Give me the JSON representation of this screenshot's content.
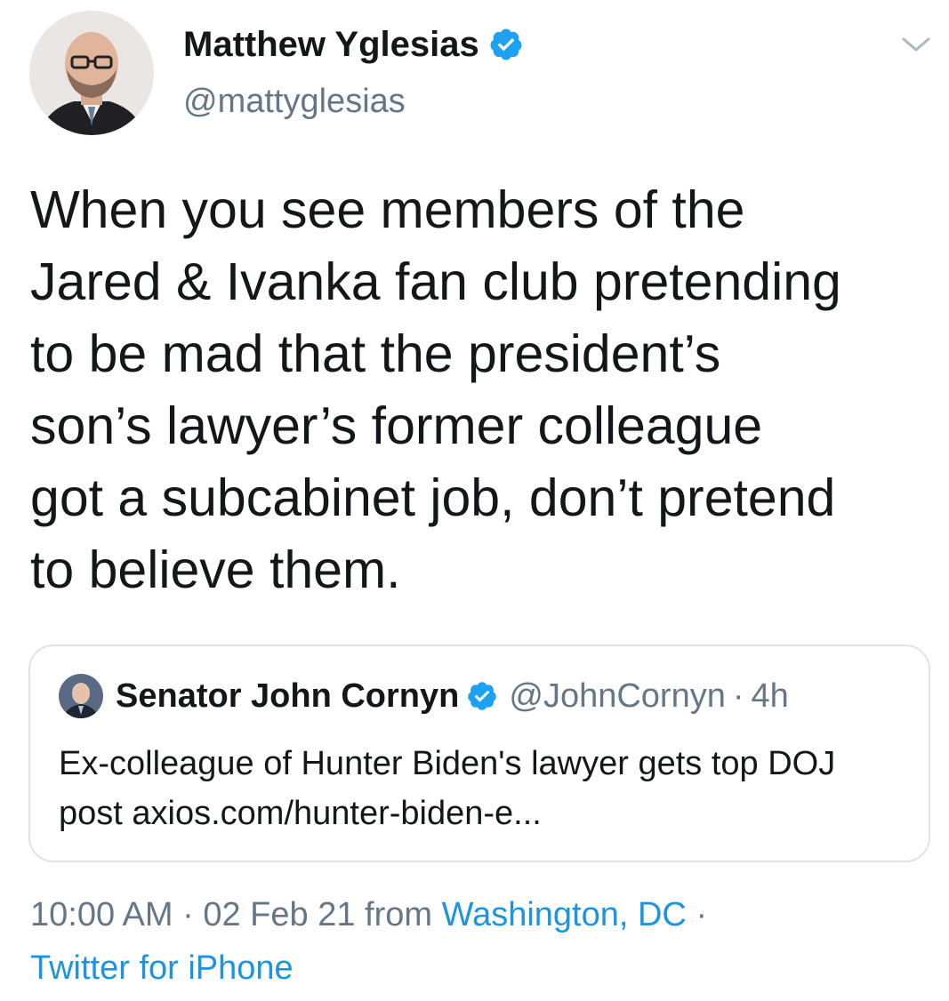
{
  "author": {
    "display_name": "Matthew Yglesias",
    "handle": "@mattyglesias",
    "verified": true
  },
  "tweet": {
    "text": "When you see members of the\nJared & Ivanka fan club pretending\nto be mad that the president’s\nson’s lawyer’s former colleague\ngot a subcabinet job, don’t pretend\nto believe them."
  },
  "quoted_tweet": {
    "display_name": "Senator John Cornyn",
    "handle": "@JohnCornyn",
    "separator": "·",
    "time": "4h",
    "text": "Ex-colleague of Hunter Biden's lawyer gets top DOJ post axios.com/hunter-biden-e...",
    "verified": true
  },
  "meta": {
    "time": "10:00 AM",
    "separator": "·",
    "date": "02 Feb 21",
    "from_label": "from",
    "location": "Washington, DC",
    "separator2": "·",
    "source": "Twitter for iPhone"
  },
  "colors": {
    "text": "#14171a",
    "secondary": "#657786",
    "link": "#1b95e0",
    "verified": "#1da1f2",
    "border": "#dde3e8"
  },
  "icons": {
    "verified": "verified-badge-icon",
    "caret": "chevron-down-icon"
  }
}
